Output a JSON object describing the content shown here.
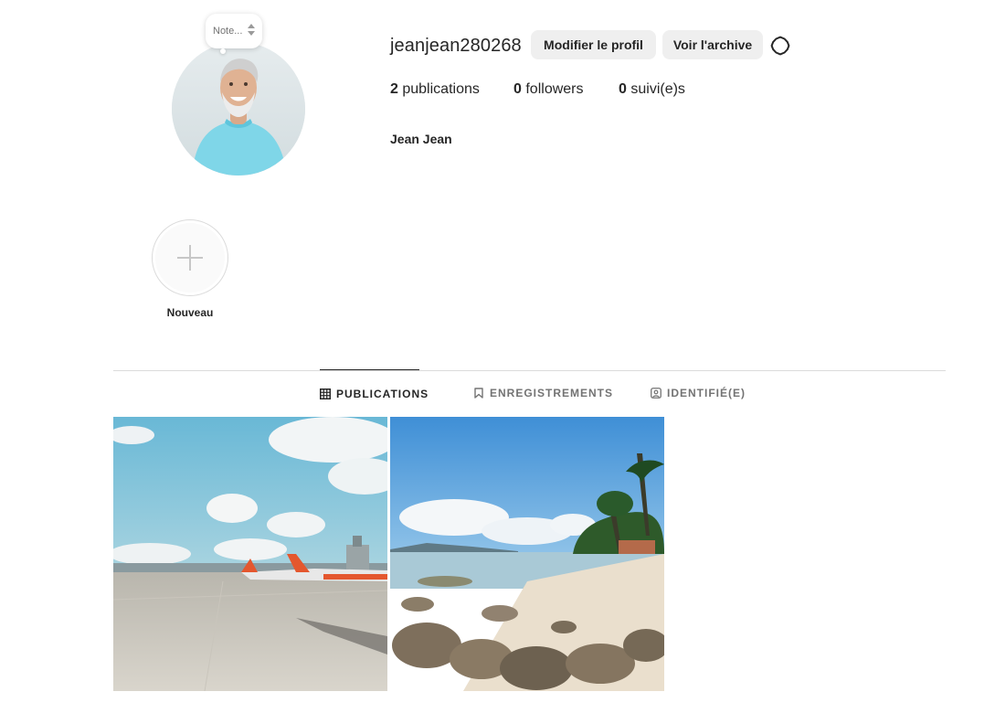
{
  "profile": {
    "note_placeholder": "Note...",
    "username": "jeanjean280268",
    "full_name": "Jean Jean",
    "edit_button_label": "Modifier le profil",
    "archive_button_label": "Voir l'archive",
    "settings_icon": "gear-icon",
    "avatar_icon": "avatar"
  },
  "stats": {
    "posts_count": "2",
    "posts_label": "publications",
    "followers_count": "0",
    "followers_label": "followers",
    "following_count": "0",
    "following_label": "suivi(e)s"
  },
  "highlights": {
    "new_label": "Nouveau",
    "new_icon": "plus-icon"
  },
  "tabs": [
    {
      "label": "PUBLICATIONS",
      "icon": "grid-icon",
      "active": true
    },
    {
      "label": "ENREGISTREMENTS",
      "icon": "bookmark-icon",
      "active": false
    },
    {
      "label": "IDENTIFIÉ(E)",
      "icon": "tagged-icon",
      "active": false
    }
  ],
  "posts": [
    {
      "subject": "airport-tarmac-photo"
    },
    {
      "subject": "rocky-beach-photo"
    }
  ],
  "colors": {
    "text_primary": "#262626",
    "text_secondary": "#737373",
    "button_bg": "#efefef",
    "divider": "#dbdbdb"
  }
}
